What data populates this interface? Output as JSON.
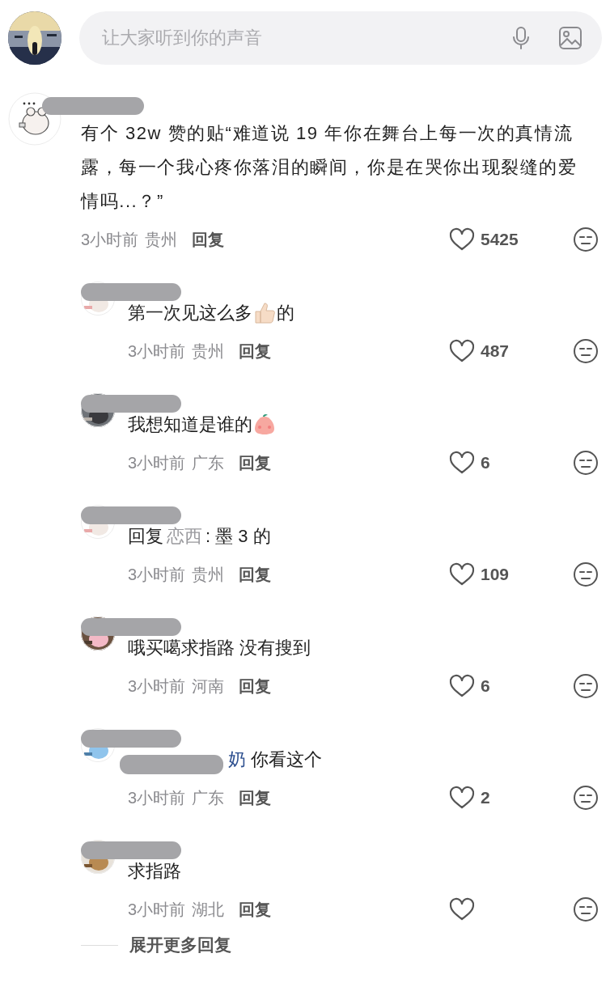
{
  "composer": {
    "placeholder": "让大家听到你的声音"
  },
  "comment": {
    "body": [
      {
        "kind": "text",
        "text": "有个 32w 赞的贴“难道说 19 年你在舞台上每一次的真情流露，每一个我心疼你落泪的瞬间，你是在哭你出现裂缝的爱情吗...？”"
      }
    ],
    "time": "3小时前",
    "location": "贵州",
    "reply": "回复",
    "likes": "5425"
  },
  "replies": [
    {
      "body": [
        {
          "kind": "text",
          "text": "第一次见这么多"
        },
        {
          "kind": "thumb"
        },
        {
          "kind": "text",
          "text": "的"
        }
      ],
      "time": "3小时前",
      "location": "贵州",
      "reply": "回复",
      "likes": "487"
    },
    {
      "body": [
        {
          "kind": "text",
          "text": "我想知道是谁的"
        },
        {
          "kind": "peach"
        }
      ],
      "time": "3小时前",
      "location": "广东",
      "reply": "回复",
      "likes": "6"
    },
    {
      "body": [
        {
          "kind": "text",
          "text": "回复"
        },
        {
          "kind": "quoted",
          "text": "恋西"
        },
        {
          "kind": "text",
          "text": ": 墨 3 的"
        }
      ],
      "time": "3小时前",
      "location": "贵州",
      "reply": "回复",
      "likes": "109"
    },
    {
      "body": [
        {
          "kind": "text",
          "text": "哦买噶求指路 没有搜到"
        }
      ],
      "time": "3小时前",
      "location": "河南",
      "reply": "回复",
      "likes": "6"
    },
    {
      "body": [
        {
          "kind": "mention",
          "text": "奶"
        },
        {
          "kind": "text",
          "text": " 你看这个"
        }
      ],
      "time": "3小时前",
      "location": "广东",
      "reply": "回复",
      "likes": "2"
    },
    {
      "body": [
        {
          "kind": "text",
          "text": "求指路"
        }
      ],
      "time": "3小时前",
      "location": "湖北",
      "reply": "回复"
    }
  ],
  "more": "展开更多回复"
}
